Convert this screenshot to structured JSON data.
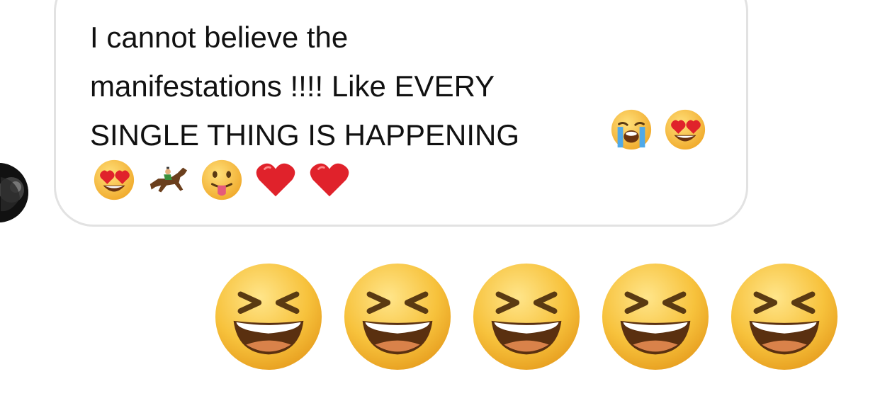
{
  "message": {
    "text_lines": [
      "I cannot believe the",
      "manifestations !!!! Like EVERY",
      "SINGLE THING IS HAPPENING"
    ],
    "inline_emojis": [
      "loudly-crying-face",
      "heart-eyes-face"
    ],
    "trailing_emojis": [
      "heart-eyes-face",
      "horse-racing",
      "face-with-tongue",
      "red-heart",
      "red-heart"
    ]
  },
  "reactions": {
    "emoji": "grinning-squinting-face",
    "count_shown": 5
  },
  "colors": {
    "bubble_border": "#e2e2e2",
    "text": "#111111",
    "emoji_yellow": "#f7c23c",
    "heart_red": "#e0222b"
  }
}
